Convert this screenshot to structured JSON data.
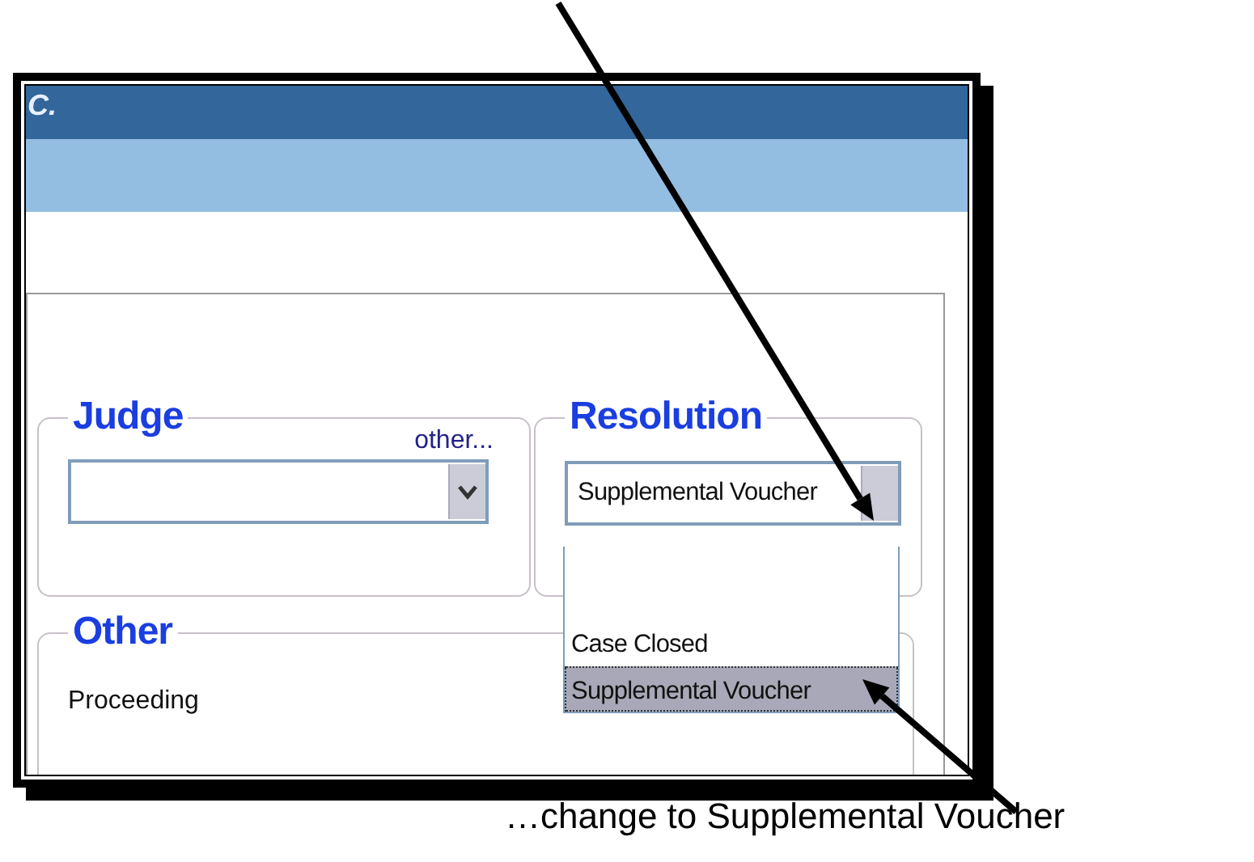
{
  "window": {
    "title": "C."
  },
  "judge": {
    "legend": "Judge",
    "link": "other..."
  },
  "resolution": {
    "legend": "Resolution",
    "value": "Supplemental Voucher",
    "expanded": true,
    "options": [
      {
        "selected": false
      },
      {
        "label": "Case Closed",
        "selected": false
      },
      {
        "label": "Supplemental Voucher",
        "selected": true
      }
    ]
  },
  "other": {
    "legend": "Other",
    "fields": [
      {
        "label": "Proceeding"
      }
    ]
  },
  "annotation": {
    "caption": "…change to Supplemental Voucher"
  }
}
